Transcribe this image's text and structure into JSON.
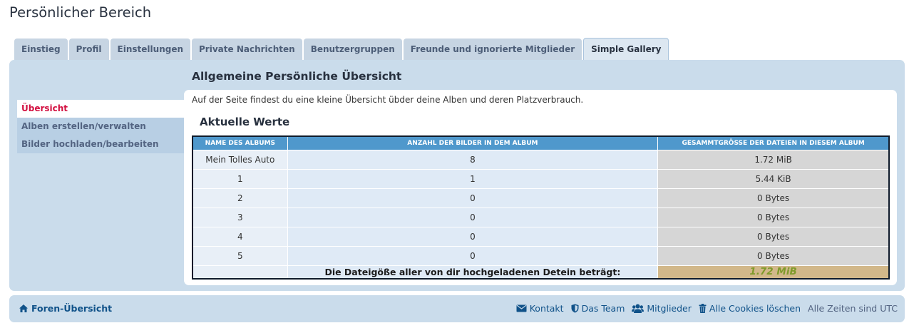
{
  "page": {
    "title": "Persönlicher Bereich"
  },
  "tabs": [
    {
      "label": "Einstieg"
    },
    {
      "label": "Profil"
    },
    {
      "label": "Einstellungen"
    },
    {
      "label": "Private Nachrichten"
    },
    {
      "label": "Benutzergruppen"
    },
    {
      "label": "Freunde und ignorierte Mitglieder"
    },
    {
      "label": "Simple Gallery",
      "active": true
    }
  ],
  "sidebar": {
    "items": [
      {
        "label": "Übersicht",
        "active": true
      },
      {
        "label": "Alben erstellen/verwalten"
      },
      {
        "label": "Bilder hochladen/bearbeiten"
      }
    ]
  },
  "content": {
    "title": "Allgemeine Persönliche Übersicht",
    "intro": "Auf der Seite findest du eine kleine Übersicht übder deine Alben und deren Platzverbrauch.",
    "section_title": "Aktuelle Werte"
  },
  "table": {
    "headers": [
      "Name des Albums",
      "Anzahl der Bilder in dem Album",
      "Gesammtgrösse der Dateien in diesem Album"
    ],
    "rows": [
      [
        "Mein Tolles Auto",
        "8",
        "1.72 MiB"
      ],
      [
        "1",
        "1",
        "5.44 KiB"
      ],
      [
        "2",
        "0",
        "0 Bytes"
      ],
      [
        "3",
        "0",
        "0 Bytes"
      ],
      [
        "4",
        "0",
        "0 Bytes"
      ],
      [
        "5",
        "0",
        "0 Bytes"
      ]
    ],
    "total_label": "Die Dateigöße aller von dir hochgeladenen Detein beträgt:",
    "total_value": "1.72 MiB"
  },
  "footer": {
    "home": "Foren-Übersicht",
    "links": [
      "Kontakt",
      "Das Team",
      "Mitglieder",
      "Alle Cookies löschen"
    ],
    "timezone": "Alle Zeiten sind UTC"
  },
  "icons": {
    "home": "home-icon",
    "contact": "envelope-icon",
    "team": "shield-icon",
    "members": "users-icon",
    "cookies": "trash-icon"
  },
  "colors": {
    "panel": "#cadceb",
    "link": "#105289",
    "active_menu": "#d31141",
    "table_header": "#4f98cc",
    "total_value": "#7f9b2a"
  }
}
